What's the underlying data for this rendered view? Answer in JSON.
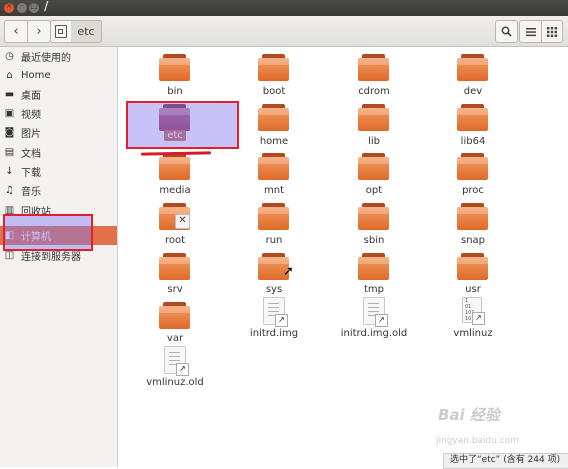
{
  "window": {
    "title": "/"
  },
  "toolbar": {
    "path_segment": "etc"
  },
  "sidebar": {
    "items": [
      {
        "icon": "clock-icon",
        "glyph": "◷",
        "label": "最近使用的"
      },
      {
        "icon": "home-icon",
        "glyph": "⌂",
        "label": "Home"
      },
      {
        "icon": "desktop-icon",
        "glyph": "▬",
        "label": "桌面"
      },
      {
        "icon": "video-icon",
        "glyph": "▣",
        "label": "视频"
      },
      {
        "icon": "camera-icon",
        "glyph": "◙",
        "label": "图片"
      },
      {
        "icon": "document-icon",
        "glyph": "▤",
        "label": "文档"
      },
      {
        "icon": "download-icon",
        "glyph": "↓",
        "label": "下载"
      },
      {
        "icon": "music-icon",
        "glyph": "♫",
        "label": "音乐"
      },
      {
        "icon": "trash-icon",
        "glyph": "▥",
        "label": "回收站"
      },
      {
        "icon": "computer-icon",
        "glyph": "◧",
        "label": "计算机",
        "active": true
      },
      {
        "icon": "network-icon",
        "glyph": "◫",
        "label": "连接到服务器"
      }
    ]
  },
  "files": [
    {
      "name": "bin",
      "type": "folder"
    },
    {
      "name": "boot",
      "type": "folder"
    },
    {
      "name": "cdrom",
      "type": "folder"
    },
    {
      "name": "dev",
      "type": "folder"
    },
    {
      "name": "etc",
      "type": "folder",
      "selected": true
    },
    {
      "name": "home",
      "type": "folder"
    },
    {
      "name": "lib",
      "type": "folder"
    },
    {
      "name": "lib64",
      "type": "folder"
    },
    {
      "name": "media",
      "type": "folder"
    },
    {
      "name": "mnt",
      "type": "folder"
    },
    {
      "name": "opt",
      "type": "folder"
    },
    {
      "name": "proc",
      "type": "folder"
    },
    {
      "name": "root",
      "type": "folder-locked"
    },
    {
      "name": "run",
      "type": "folder"
    },
    {
      "name": "sbin",
      "type": "folder"
    },
    {
      "name": "snap",
      "type": "folder"
    },
    {
      "name": "srv",
      "type": "folder"
    },
    {
      "name": "sys",
      "type": "folder"
    },
    {
      "name": "tmp",
      "type": "folder"
    },
    {
      "name": "usr",
      "type": "folder"
    },
    {
      "name": "var",
      "type": "folder"
    },
    {
      "name": "initrd.img",
      "type": "file-link"
    },
    {
      "name": "initrd.img.old",
      "type": "file-link"
    },
    {
      "name": "vmlinuz",
      "type": "binary-link"
    },
    {
      "name": "vmlinuz.old",
      "type": "file-link"
    }
  ],
  "status": {
    "text": "选中了“etc” (含有 244 项)"
  },
  "watermark": {
    "text": "Bai 经验",
    "sub": "jingyan.baidu.com"
  },
  "colors": {
    "accent": "#e0714a",
    "folder": "#ef8a4c",
    "highlight_border": "#e0202a"
  }
}
